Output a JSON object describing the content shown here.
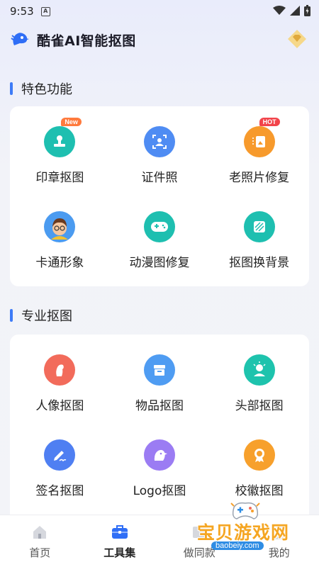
{
  "status": {
    "time": "9:53",
    "sim_label": "A"
  },
  "app": {
    "title": "酷雀AI智能抠图"
  },
  "featured": {
    "title": "特色功能",
    "items": [
      {
        "label": "印章抠图",
        "badge": "New",
        "color": "#1ebfb0"
      },
      {
        "label": "证件照",
        "badge": "",
        "color": "#4f8cf3"
      },
      {
        "label": "老照片修复",
        "badge": "HOT",
        "color": "#f79a2c"
      },
      {
        "label": "卡通形象",
        "badge": "",
        "color": "#4b9bf0"
      },
      {
        "label": "动漫图修复",
        "badge": "",
        "color": "#1ebfb0"
      },
      {
        "label": "抠图换背景",
        "badge": "",
        "color": "#1ebfb0"
      }
    ]
  },
  "pro": {
    "title": "专业抠图",
    "items": [
      {
        "label": "人像抠图",
        "color": "#f26b5b"
      },
      {
        "label": "物品抠图",
        "color": "#4f9cf2"
      },
      {
        "label": "头部抠图",
        "color": "#1ec3ad"
      },
      {
        "label": "签名抠图",
        "color": "#4f7ff2"
      },
      {
        "label": "Logo抠图",
        "color": "#9b7cf3"
      },
      {
        "label": "校徽抠图",
        "color": "#f7a02c"
      }
    ]
  },
  "tabbar": {
    "items": [
      {
        "label": "首页"
      },
      {
        "label": "工具集"
      },
      {
        "label": "做同款"
      },
      {
        "label": "我的"
      }
    ]
  },
  "watermark": {
    "title": "宝贝游戏网",
    "url": "baobeiy.com"
  }
}
